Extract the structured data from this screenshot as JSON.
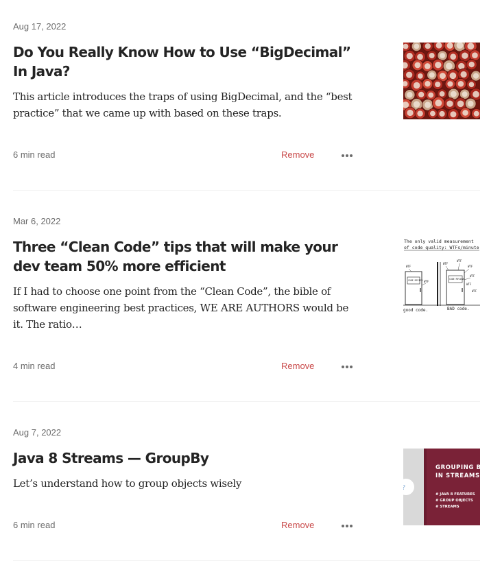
{
  "articles": [
    {
      "date": "Aug 17, 2022",
      "title": "Do You Really Know How to Use “BigDecimal” In Java?",
      "subtitle": "This article introduces the traps of using BigDecimal, and the “best practice” that we came up with based on these traps.",
      "read_time": "6 min read",
      "remove_label": "Remove",
      "thumbnail": "red-bingo-chips-image"
    },
    {
      "date": "Mar 6, 2022",
      "title": "Three “Clean Code” tips that will make your dev team 50% more efficient",
      "subtitle": "If I had to choose one point from the “Clean Code”, the bible of software engineering best practices, WE ARE AUTHORS would be it. The ratio…",
      "read_time": "4 min read",
      "remove_label": "Remove",
      "thumbnail": "wtfs-per-minute-cartoon-image",
      "thumb_text": {
        "heading_1": "The only valid measurement",
        "heading_2": "of code quality: WTFs/minute",
        "wtf": "WTF",
        "door_left": "CODE REVIEW",
        "door_right": "CODE REVIEW",
        "caption_left": "good code.",
        "caption_right": "BAD code."
      }
    },
    {
      "date": "Aug 7, 2022",
      "title": "Java 8 Streams — GroupBy",
      "subtitle": "Let’s understand how to group objects wisely",
      "read_time": "6 min read",
      "remove_label": "Remove",
      "thumbnail": "grouping-by-in-streams-banner-image",
      "thumb_text": {
        "heading_1": "GROUPING BY",
        "heading_2": "IN STREAMS",
        "bullet_1": "# JAVA 8 FEATURES",
        "bullet_2": "# GROUP OBJECTS",
        "bullet_3": "# STREAMS"
      }
    }
  ],
  "colors": {
    "text": "#242424",
    "meta": "#6b6b6b",
    "remove": "#c94a4a",
    "divider": "#f2f2f2",
    "banner": "#7a2237"
  },
  "icons": {
    "more": "more-horizontal-icon"
  }
}
